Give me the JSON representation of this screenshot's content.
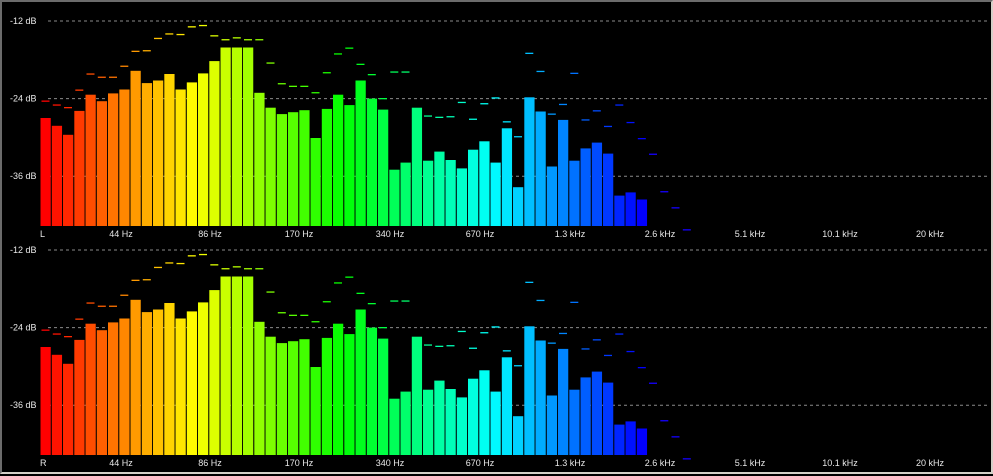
{
  "db_labels": [
    "-12 dB",
    "-24 dB",
    "-36 dB"
  ],
  "freq_labels": [
    "44 Hz",
    "86 Hz",
    "170 Hz",
    "340 Hz",
    "670 Hz",
    "1.3 kHz",
    "2.6 kHz",
    "5.1 kHz",
    "10.1 kHz",
    "20 kHz"
  ],
  "channels": [
    {
      "name": "L",
      "levels": [
        -27.0,
        -28.2,
        -29.6,
        -25.9,
        -23.4,
        -24.4,
        -23.2,
        -22.6,
        -19.7,
        -21.6,
        -21.2,
        -20.2,
        -22.6,
        -21.5,
        -20.1,
        -18.2,
        -16.1,
        -16.1,
        -16.1,
        -23.1,
        -25.4,
        -26.4,
        -26.1,
        -25.8,
        -30.1,
        -25.6,
        -23.4,
        -25.0,
        -21.2,
        -24.0,
        -25.7,
        -35.0,
        -33.9,
        -25.4,
        -33.6,
        -32.2,
        -33.5,
        -34.8,
        -31.9,
        -30.6,
        -33.9,
        -28.6,
        -37.7,
        -23.8,
        -26.0,
        -34.5,
        -27.3,
        -33.6,
        -31.7,
        -30.8,
        -32.5,
        -39.0,
        -38.5,
        -39.6,
        -44.7,
        null,
        null,
        null,
        null,
        null,
        null
      ],
      "peaks": [
        -24.3,
        -24.9,
        -25.3,
        -22.6,
        -20.1,
        -20.6,
        -20.6,
        -18.9,
        -16.6,
        -16.5,
        -14.6,
        -13.9,
        -14.0,
        -12.8,
        -12.6,
        -14.2,
        -14.8,
        -14.5,
        -14.8,
        -14.8,
        -18.4,
        -21.6,
        -22.0,
        -22.0,
        -23.0,
        -19.9,
        -17.0,
        -16.1,
        -18.6,
        -20.2,
        -23.9,
        -19.8,
        -19.8,
        -26.2,
        -26.6,
        -26.8,
        -26.7,
        -24.5,
        -27.1,
        -24.7,
        -23.8,
        -27.5,
        -29.8,
        -16.9,
        -19.7,
        -26.3,
        -24.8,
        -20.0,
        -27.2,
        -25.8,
        -28.2,
        -24.9,
        -27.6,
        -30.1,
        -32.5,
        -38.3,
        -40.8,
        -44.2,
        null,
        null,
        null
      ]
    },
    {
      "name": "R",
      "levels": [
        -27.0,
        -28.2,
        -29.6,
        -25.9,
        -23.4,
        -24.4,
        -23.2,
        -22.6,
        -19.7,
        -21.6,
        -21.2,
        -20.2,
        -22.6,
        -21.5,
        -20.1,
        -18.2,
        -16.1,
        -16.1,
        -16.1,
        -23.1,
        -25.4,
        -26.4,
        -26.1,
        -25.8,
        -30.1,
        -25.6,
        -23.4,
        -25.0,
        -21.2,
        -24.0,
        -25.7,
        -35.0,
        -33.9,
        -25.4,
        -33.6,
        -32.2,
        -33.5,
        -34.8,
        -31.9,
        -30.6,
        -33.9,
        -28.6,
        -37.7,
        -23.8,
        -26.0,
        -34.5,
        -27.3,
        -33.6,
        -31.7,
        -30.8,
        -32.5,
        -39.0,
        -38.5,
        -39.6,
        -44.7,
        null,
        null,
        null,
        null,
        null,
        null
      ],
      "peaks": [
        -24.3,
        -24.9,
        -25.3,
        -22.6,
        -20.1,
        -20.6,
        -20.6,
        -18.9,
        -16.6,
        -16.5,
        -14.6,
        -13.9,
        -14.0,
        -12.8,
        -12.6,
        -14.2,
        -14.8,
        -14.5,
        -14.8,
        -14.8,
        -18.4,
        -21.6,
        -22.0,
        -22.0,
        -23.0,
        -19.9,
        -17.0,
        -16.1,
        -18.6,
        -20.2,
        -23.9,
        -19.8,
        -19.8,
        -26.2,
        -26.6,
        -26.8,
        -26.7,
        -24.5,
        -27.1,
        -24.7,
        -23.8,
        -27.5,
        -29.8,
        -16.9,
        -19.7,
        -26.3,
        -24.8,
        -20.0,
        -27.2,
        -25.8,
        -28.2,
        -24.9,
        -27.6,
        -30.1,
        -32.5,
        -38.3,
        -40.8,
        -44.2,
        null,
        null,
        null
      ]
    }
  ]
}
